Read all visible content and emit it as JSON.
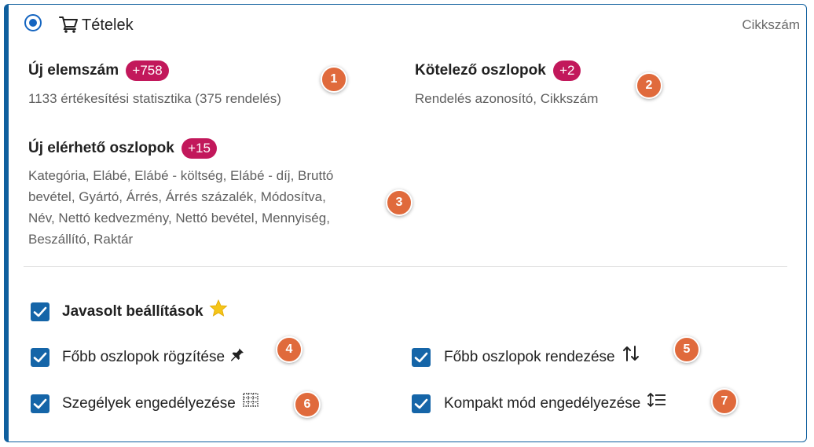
{
  "header": {
    "title": "Tételek",
    "right_label": "Cikkszám"
  },
  "sections": {
    "new_items": {
      "title": "Új elemszám",
      "badge": "+758",
      "description": "1133 értékesítési statisztika (375 rendelés)"
    },
    "required_columns": {
      "title": "Kötelező oszlopok",
      "badge": "+2",
      "description": "Rendelés azonosító, Cikkszám"
    },
    "new_columns": {
      "title": "Új elérhető oszlopok",
      "badge": "+15",
      "description_lines": [
        "Kategória, Elábé, Elábé - költség, Elábé - díj, Bruttó",
        "bevétel, Gyártó, Árrés, Árrés százalék, Módosítva,",
        "Név, Nettó kedvezmény, Nettó bevétel, Mennyiség,",
        "Beszállító, Raktár"
      ]
    }
  },
  "options": {
    "recommended": {
      "label": "Javasolt beállítások",
      "checked": true
    },
    "pin_columns": {
      "label": "Főbb oszlopok rögzítése",
      "checked": true
    },
    "sort_columns": {
      "label": "Főbb oszlopok rendezése",
      "checked": true
    },
    "borders": {
      "label": "Szegélyek engedélyezése",
      "checked": true
    },
    "compact": {
      "label": "Kompakt mód engedélyezése",
      "checked": true
    }
  },
  "markers": [
    "1",
    "2",
    "3",
    "4",
    "5",
    "6",
    "7"
  ],
  "colors": {
    "accent": "#0f5f9e",
    "checkbox": "#1565a8",
    "badge": "#c2185b",
    "marker": "#e06a3c",
    "star": "#f5c518"
  },
  "icons": {
    "cart": "cart-icon",
    "star": "star-icon",
    "pin": "pin-icon",
    "sort": "sort-arrows-icon",
    "borders": "border-grid-icon",
    "compact": "line-height-icon"
  }
}
